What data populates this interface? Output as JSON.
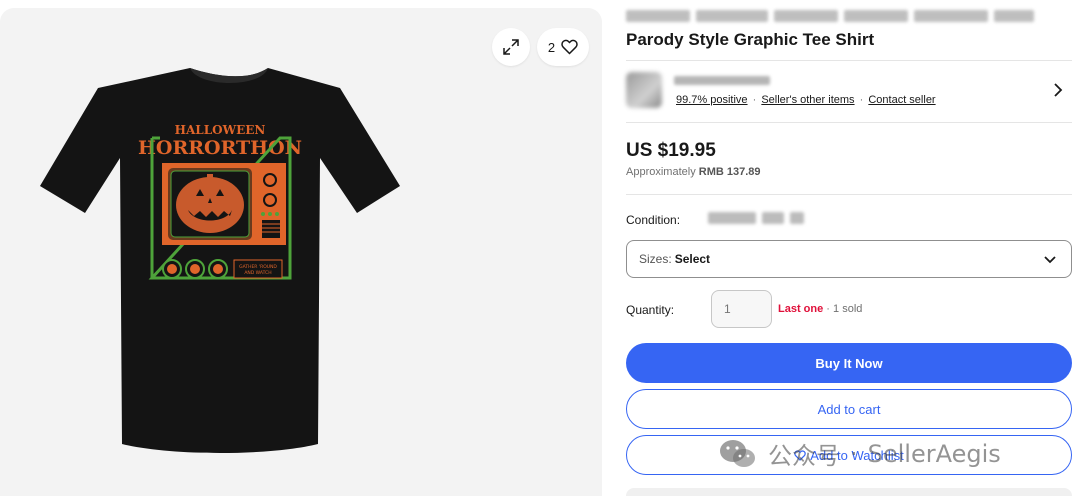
{
  "gallery": {
    "watch_count": "2",
    "expand_icon": "expand-icon",
    "heart_icon": "heart-icon",
    "shirt": {
      "shirt_color": "#141414",
      "print_line1": "HALLOWEEN",
      "print_line2": "HORRORTHON",
      "print_tagline_1": "GATHER 'ROUND",
      "print_tagline_2": "AND WATCH",
      "accent_orange": "#e0652a",
      "accent_green": "#4ea33a"
    }
  },
  "listing": {
    "title_visible": "Parody Style Graphic Tee Shirt"
  },
  "seller": {
    "feedback": "99.7% positive",
    "other_items": "Seller's other items",
    "contact": "Contact seller",
    "separator": "·",
    "chevron_icon": "chevron-right-icon"
  },
  "price": {
    "main": "US $19.95",
    "approx_prefix": "Approximately",
    "approx_value": "RMB 137.89"
  },
  "condition": {
    "label": "Condition:"
  },
  "sizes": {
    "label": "Sizes:",
    "selected": "Select",
    "chevron_icon": "chevron-down-icon"
  },
  "quantity": {
    "label": "Quantity:",
    "placeholder": "1",
    "last_one": "Last one",
    "separator": "·",
    "sold": "1 sold"
  },
  "actions": {
    "buy_now": "Buy It Now",
    "add_to_cart": "Add to cart",
    "add_to_watchlist": "Add to Watchlist"
  },
  "watermark": {
    "text_cn": "公众号",
    "text_brand": "SellerAegis"
  },
  "colors": {
    "primary_blue": "#3665f3",
    "alert_red": "#e0103a",
    "gallery_bg": "#f3f3f3"
  }
}
